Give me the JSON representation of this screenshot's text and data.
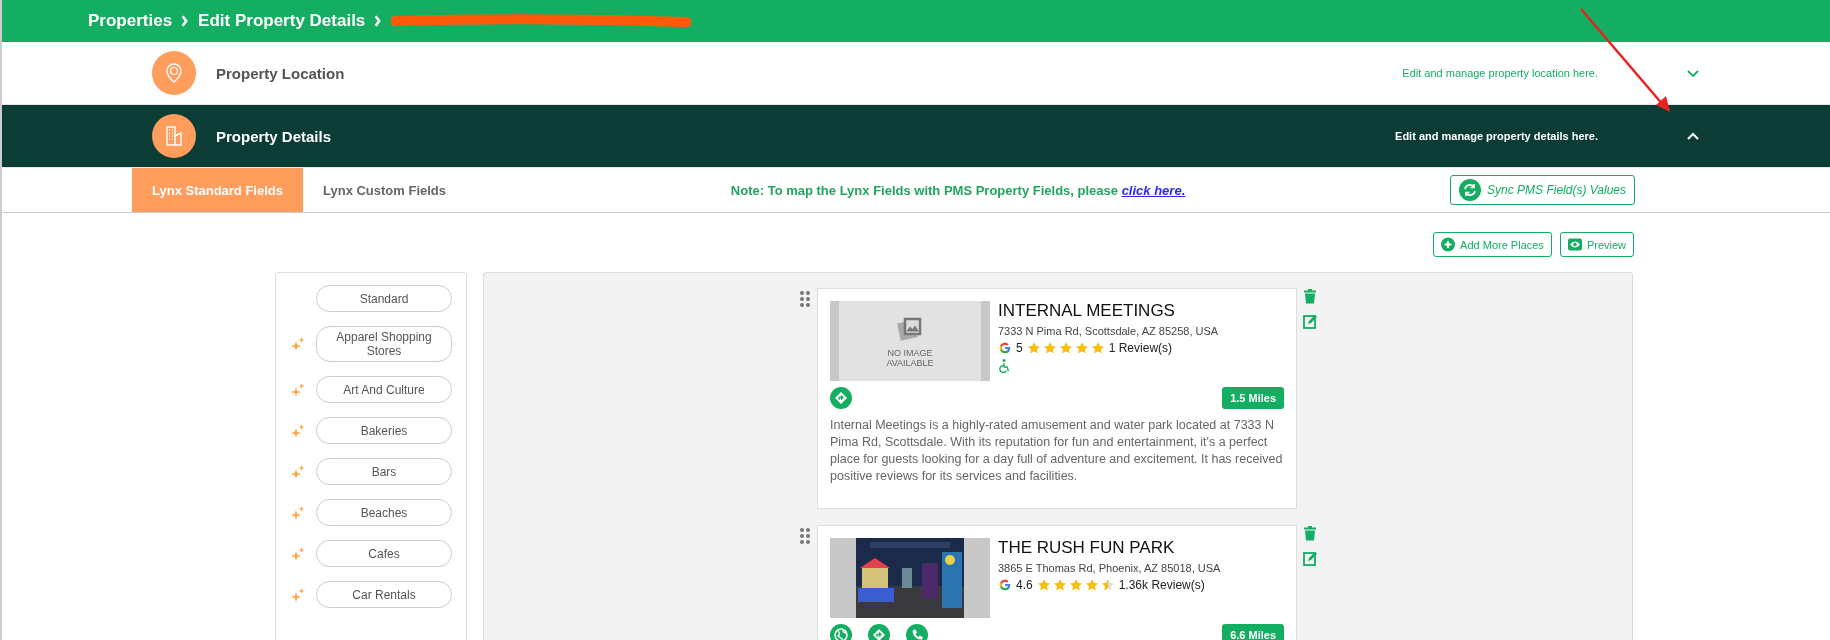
{
  "breadcrumb": [
    "Properties",
    "Edit Property Details"
  ],
  "sections": [
    {
      "title": "Property Location",
      "description": "Edit and manage property location here.",
      "kind": "location",
      "expanded": false
    },
    {
      "title": "Property Details",
      "description": "Edit and manage property details here.",
      "kind": "building",
      "expanded": true
    }
  ],
  "tabs": [
    {
      "label": "Lynx Standard Fields",
      "selected": true
    },
    {
      "label": "Lynx Custom Fields",
      "selected": false
    }
  ],
  "note": {
    "text": "Note: To map the Lynx Fields with PMS Property Fields, please",
    "link": "click here."
  },
  "sync_button": "Sync PMS Field(s) Values",
  "toolbar": [
    {
      "label": "Add More Places",
      "kind": "add"
    },
    {
      "label": "Preview",
      "kind": "preview"
    }
  ],
  "categories": [
    {
      "label": "Standard",
      "sparkle": false
    },
    {
      "label": "Apparel Shopping Stores",
      "sparkle": true
    },
    {
      "label": "Art And Culture",
      "sparkle": true
    },
    {
      "label": "Bakeries",
      "sparkle": true
    },
    {
      "label": "Bars",
      "sparkle": true
    },
    {
      "label": "Beaches",
      "sparkle": true
    },
    {
      "label": "Cafes",
      "sparkle": true
    },
    {
      "label": "Car Rentals",
      "sparkle": true
    }
  ],
  "places": [
    {
      "name": "INTERNAL MEETINGS",
      "address": "7333 N Pima Rd, Scottsdale, AZ 85258, USA",
      "rating": "5",
      "stars": 5,
      "reviews": "1 Review(s)",
      "accessible": true,
      "image": {
        "kind": "placeholder",
        "text": "NO IMAGE AVAILABLE"
      },
      "actions": [
        {
          "kind": "directions"
        }
      ],
      "distance": "1.5 Miles",
      "description": "Internal Meetings is a highly-rated amusement and water park located at 7333 N Pima Rd, Scottsdale. With its reputation for fun and entertainment, it's a perfect place for guests looking for a day full of adventure and excitement. It has received positive reviews for its services and facilities."
    },
    {
      "name": "THE RUSH FUN PARK",
      "address": "3865 E Thomas Rd, Phoenix, AZ 85018, USA",
      "rating": "4.6",
      "stars": 4.5,
      "reviews": "1.36k Review(s)",
      "accessible": false,
      "actions": [
        {
          "kind": "website"
        },
        {
          "kind": "directions"
        },
        {
          "kind": "phone"
        }
      ],
      "distance": "6.6 Miles"
    }
  ]
}
